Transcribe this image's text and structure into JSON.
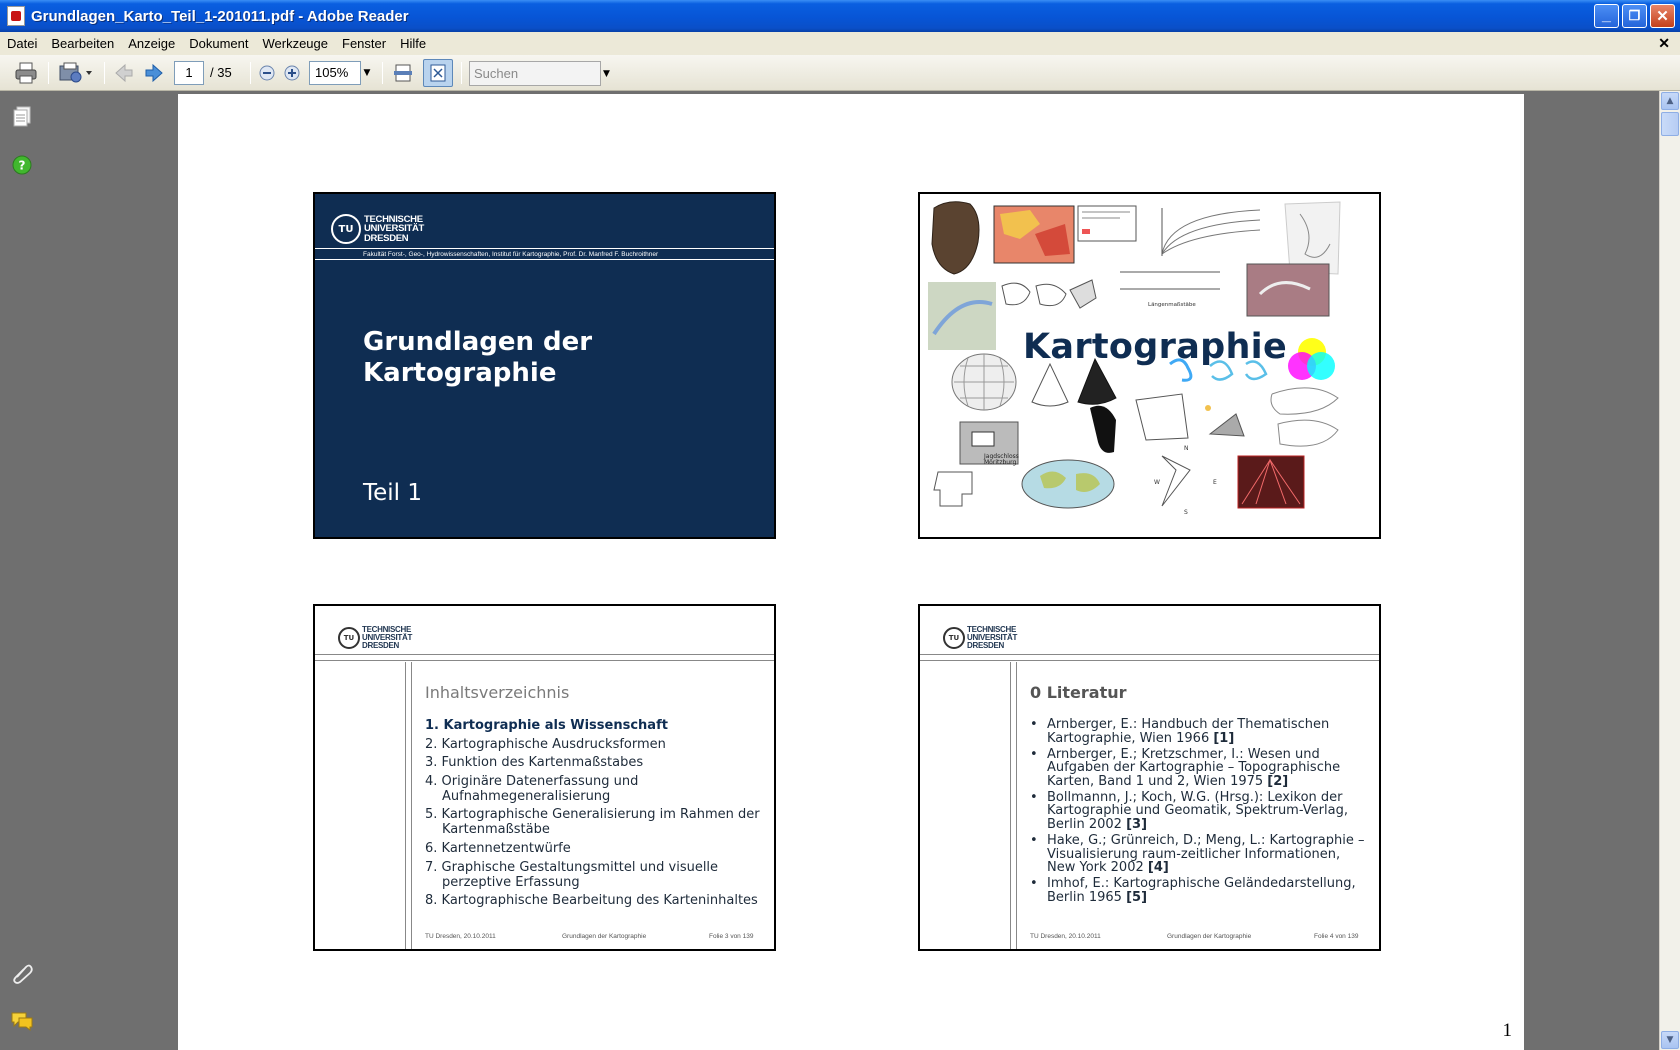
{
  "window": {
    "title": "Grundlagen_Karto_Teil_1-201011.pdf - Adobe Reader",
    "minimize": "_",
    "maximize": "❐",
    "close": "✕"
  },
  "menu": [
    "Datei",
    "Bearbeiten",
    "Anzeige",
    "Dokument",
    "Werkzeuge",
    "Fenster",
    "Hilfe"
  ],
  "menu_close": "✕",
  "toolbar": {
    "page_current": "1",
    "page_total": "/ 35",
    "zoom": "105%",
    "search_placeholder": "Suchen"
  },
  "document": {
    "page_number": "1",
    "slide1": {
      "logo": [
        "TECHNISCHE",
        "UNIVERSITÄT",
        "DRESDEN"
      ],
      "faculty": "Fakultät Forst-, Geo-, Hydrowissenschaften, Institut für Kartographie,  Prof. Dr. Manfred F. Buchroithner",
      "title_line1": "Grundlagen der",
      "title_line2": "Kartographie",
      "subtitle": "Teil 1"
    },
    "slide2": {
      "title": "Kartographie",
      "labels": {
        "small1": "Jagdschloss",
        "small2": "Moritzburg",
        "chart_note": "Längenmaßstäbe",
        "compass_n": "N",
        "compass_s": "S",
        "compass_w": "W",
        "compass_e": "E"
      }
    },
    "slide3": {
      "logo": [
        "TECHNISCHE",
        "UNIVERSITÄT",
        "DRESDEN"
      ],
      "heading": "Inhaltsverzeichnis",
      "items": [
        "1. Kartographie als Wissenschaft",
        "2. Kartographische Ausdrucksformen",
        "3. Funktion des Kartenmaßstabes",
        "4. Originäre Datenerfassung und Aufnahmegeneralisierung",
        "5. Kartographische Generalisierung im Rahmen der Kartenmaßstäbe",
        "6.  Kartennetzentwürfe",
        "7. Graphische Gestaltungsmittel und visuelle perzeptive Erfassung",
        "8. Kartographische Bearbeitung des Karteninhaltes"
      ],
      "footer_left": "TU Dresden, 20.10.2011",
      "footer_center": "Grundlagen der Kartographie",
      "footer_right": "Folie 3 von 139"
    },
    "slide4": {
      "logo": [
        "TECHNISCHE",
        "UNIVERSITÄT",
        "DRESDEN"
      ],
      "heading": "0 Literatur",
      "items": [
        {
          "text": "Arnberger, E.: Handbuch der Thematischen Kartographie, Wien 1966 ",
          "ref": "[1]"
        },
        {
          "text": "Arnberger, E.; Kretzschmer, I.: Wesen und Aufgaben der Kartographie – Topographische Karten, Band 1 und 2, Wien 1975 ",
          "ref": "[2]"
        },
        {
          "text": "Bollmannn, J.; Koch, W.G. (Hrsg.): Lexikon der Kartographie und Geomatik, Spektrum-Verlag, Berlin 2002 ",
          "ref": "[3]"
        },
        {
          "text": "Hake, G.;  Grünreich, D.; Meng, L.: Kartographie – Visualisierung raum-zeitlicher Informationen, New York 2002 ",
          "ref": "[4]"
        },
        {
          "text": "Imhof, E.: Kartographische Geländedarstellung, Berlin 1965 ",
          "ref": "[5]"
        }
      ],
      "footer_left": "TU Dresden, 20.10.2011",
      "footer_center": "Grundlagen der Kartographie",
      "footer_right": "Folie 4 von 139"
    }
  },
  "colors": {
    "tud_blue": "#0f2d52",
    "xp_title_blue": "#0755d6",
    "xp_face": "#ece9d8",
    "workspace_gray": "#6f6f6f"
  }
}
